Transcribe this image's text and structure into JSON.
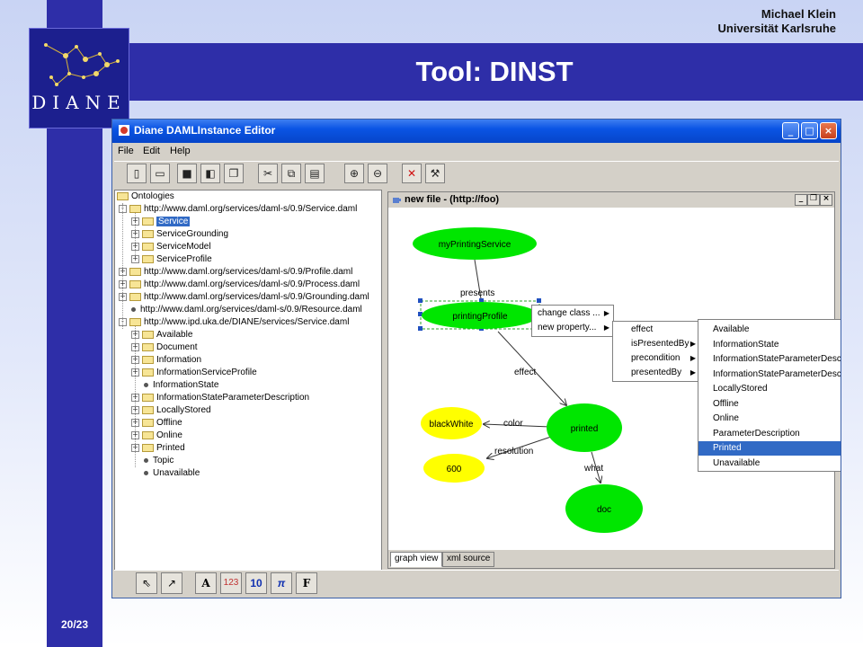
{
  "slide": {
    "author_name": "Michael Klein",
    "author_affiliation": "Universität Karlsruhe",
    "title": "Tool: DINST",
    "page_number": "20/23",
    "logo_text": "DIANE"
  },
  "window": {
    "title": "Diane DAMLInstance Editor"
  },
  "menubar": [
    "File",
    "Edit",
    "Help"
  ],
  "toolbar_icons": [
    "new-file-icon",
    "open-folder-icon",
    "save-icon",
    "save-as-icon",
    "save-all-icon",
    "cut-icon",
    "copy-icon",
    "paste-icon",
    "zoom-in-icon",
    "zoom-out-icon",
    "delete-icon",
    "tools-icon"
  ],
  "tree": {
    "root": "Ontologies",
    "items": [
      {
        "label": "http://www.daml.org/services/daml-s/0.9/Service.daml",
        "level": 1,
        "kind": "folder",
        "exp": "-"
      },
      {
        "label": "Service",
        "level": 2,
        "kind": "folder",
        "exp": "+",
        "selected": true
      },
      {
        "label": "ServiceGrounding",
        "level": 2,
        "kind": "folder",
        "exp": "+"
      },
      {
        "label": "ServiceModel",
        "level": 2,
        "kind": "folder",
        "exp": "+"
      },
      {
        "label": "ServiceProfile",
        "level": 2,
        "kind": "folder",
        "exp": "+"
      },
      {
        "label": "http://www.daml.org/services/daml-s/0.9/Profile.daml",
        "level": 1,
        "kind": "folder",
        "exp": "+"
      },
      {
        "label": "http://www.daml.org/services/daml-s/0.9/Process.daml",
        "level": 1,
        "kind": "folder",
        "exp": "+"
      },
      {
        "label": "http://www.daml.org/services/daml-s/0.9/Grounding.daml",
        "level": 1,
        "kind": "folder",
        "exp": "+"
      },
      {
        "label": "http://www.daml.org/services/daml-s/0.9/Resource.daml",
        "level": 1,
        "kind": "leaf",
        "exp": ""
      },
      {
        "label": "http://www.ipd.uka.de/DIANE/services/Service.daml",
        "level": 1,
        "kind": "folder",
        "exp": "-"
      },
      {
        "label": "Available",
        "level": 2,
        "kind": "folder",
        "exp": "+"
      },
      {
        "label": "Document",
        "level": 2,
        "kind": "folder",
        "exp": "+"
      },
      {
        "label": "Information",
        "level": 2,
        "kind": "folder",
        "exp": "+"
      },
      {
        "label": "InformationServiceProfile",
        "level": 2,
        "kind": "folder",
        "exp": "+"
      },
      {
        "label": "InformationState",
        "level": 2,
        "kind": "leaf",
        "exp": ""
      },
      {
        "label": "InformationStateParameterDescription",
        "level": 2,
        "kind": "folder",
        "exp": "+"
      },
      {
        "label": "LocallyStored",
        "level": 2,
        "kind": "folder",
        "exp": "+"
      },
      {
        "label": "Offline",
        "level": 2,
        "kind": "folder",
        "exp": "+"
      },
      {
        "label": "Online",
        "level": 2,
        "kind": "folder",
        "exp": "+"
      },
      {
        "label": "Printed",
        "level": 2,
        "kind": "folder",
        "exp": "+"
      },
      {
        "label": "Topic",
        "level": 2,
        "kind": "leaf",
        "exp": ""
      },
      {
        "label": "Unavailable",
        "level": 2,
        "kind": "leaf",
        "exp": ""
      }
    ]
  },
  "inner_frame": {
    "title": "new file - (http://foo)",
    "tabs": [
      "graph view",
      "xml source"
    ],
    "active_tab": "graph view"
  },
  "graph": {
    "nodes": [
      {
        "id": "myPrintingService",
        "label": "myPrintingService",
        "color": "#00e600"
      },
      {
        "id": "printingProfile",
        "label": "printingProfile",
        "color": "#00e600"
      },
      {
        "id": "blackWhite",
        "label": "blackWhite",
        "color": "#ffff00"
      },
      {
        "id": "600",
        "label": "600",
        "color": "#ffff00"
      },
      {
        "id": "printed",
        "label": "printed",
        "color": "#00e600"
      },
      {
        "id": "doc",
        "label": "doc",
        "color": "#00e600"
      }
    ],
    "edges": [
      {
        "from": "myPrintingService",
        "to": "printingProfile",
        "label": "presents"
      },
      {
        "from": "printingProfile",
        "to": "printed",
        "label": "effect"
      },
      {
        "from": "printed",
        "to": "blackWhite",
        "label": "color"
      },
      {
        "from": "printed",
        "to": "600",
        "label": "resolution"
      },
      {
        "from": "printed",
        "to": "doc",
        "label": "what"
      }
    ]
  },
  "context_menu": [
    "change class ...",
    "new property..."
  ],
  "property_menu": [
    "effect",
    "isPresentedBy",
    "precondition",
    "presentedBy"
  ],
  "class_menu": {
    "items": [
      "Available",
      "InformationState",
      "InformationStateParameterDescrip",
      "InformationStateParameterDescrip",
      "LocallyStored",
      "Offline",
      "Online",
      "ParameterDescription",
      "Printed",
      "Unavailable"
    ],
    "highlighted": "Printed"
  },
  "palette": {
    "text_tool": "A",
    "number_tool": "123",
    "integer_tool": "10",
    "pi_tool": "π",
    "format_tool": "F"
  }
}
